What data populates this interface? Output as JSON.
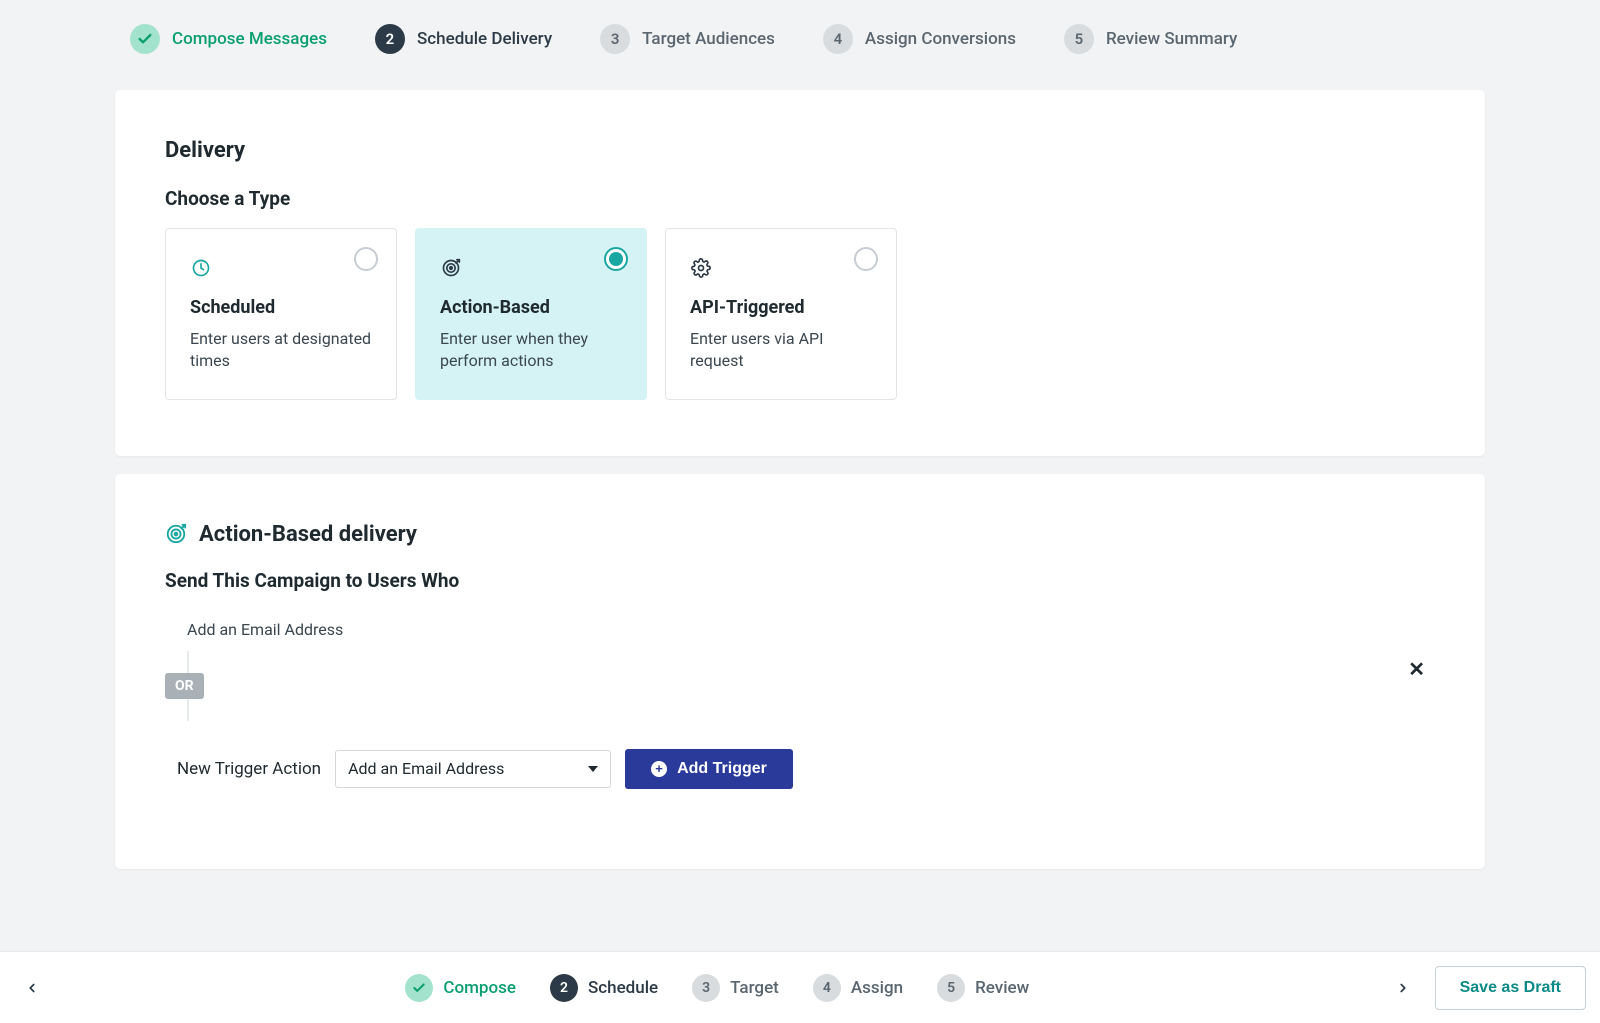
{
  "stepper": {
    "steps": [
      {
        "label": "Compose Messages",
        "state": "done"
      },
      {
        "num": "2",
        "label": "Schedule Delivery",
        "state": "current"
      },
      {
        "num": "3",
        "label": "Target Audiences",
        "state": "pending"
      },
      {
        "num": "4",
        "label": "Assign Conversions",
        "state": "pending"
      },
      {
        "num": "5",
        "label": "Review Summary",
        "state": "pending"
      }
    ]
  },
  "delivery": {
    "title": "Delivery",
    "choose_type": "Choose a Type",
    "types": [
      {
        "title": "Scheduled",
        "desc": "Enter users at designated times",
        "selected": false,
        "icon": "clock-icon"
      },
      {
        "title": "Action-Based",
        "desc": "Enter user when they perform actions",
        "selected": true,
        "icon": "target-icon"
      },
      {
        "title": "API-Triggered",
        "desc": "Enter users via API request",
        "selected": false,
        "icon": "gear-icon"
      }
    ]
  },
  "action_based": {
    "title": "Action-Based delivery",
    "send_to": "Send This Campaign to Users Who",
    "existing_trigger": "Add an Email Address",
    "or_label": "OR",
    "new_trigger_label": "New Trigger Action",
    "select_value": "Add an Email Address",
    "add_trigger_btn": "Add Trigger"
  },
  "footer": {
    "steps": [
      {
        "label": "Compose",
        "state": "done"
      },
      {
        "num": "2",
        "label": "Schedule",
        "state": "current"
      },
      {
        "num": "3",
        "label": "Target",
        "state": "pending"
      },
      {
        "num": "4",
        "label": "Assign",
        "state": "pending"
      },
      {
        "num": "5",
        "label": "Review",
        "state": "pending"
      }
    ],
    "save_draft": "Save as Draft"
  }
}
